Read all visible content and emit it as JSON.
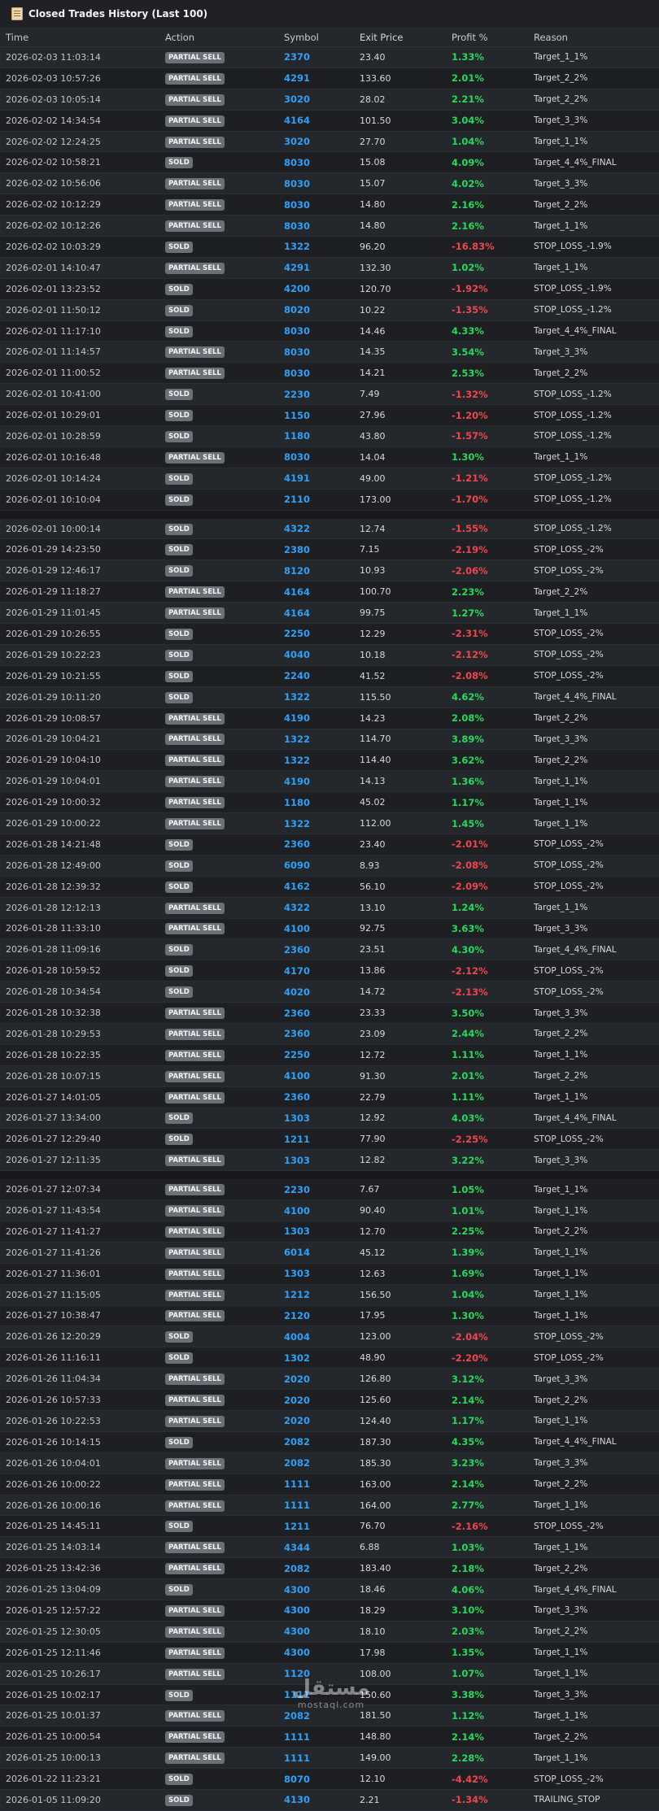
{
  "header": {
    "title": "Closed Trades History (Last 100)",
    "icon": "scroll-icon"
  },
  "columns": {
    "time": "Time",
    "action": "Action",
    "symbol": "Symbol",
    "exit_price": "Exit Price",
    "profit": "Profit %",
    "reason": "Reason"
  },
  "colors": {
    "positive": "#28d85c",
    "negative": "#f0454c",
    "symbol": "#2fa0f5",
    "badge": "#6b6f76"
  },
  "watermark": {
    "main": "مستقل",
    "sub": "mostaql.com"
  },
  "trades": [
    {
      "time": "2026-02-03 11:03:14",
      "action": "PARTIAL SELL",
      "symbol": "2370",
      "exit_price": "23.40",
      "profit": "1.33%",
      "reason": "Target_1_1%"
    },
    {
      "time": "2026-02-03 10:57:26",
      "action": "PARTIAL SELL",
      "symbol": "4291",
      "exit_price": "133.60",
      "profit": "2.01%",
      "reason": "Target_2_2%"
    },
    {
      "time": "2026-02-03 10:05:14",
      "action": "PARTIAL SELL",
      "symbol": "3020",
      "exit_price": "28.02",
      "profit": "2.21%",
      "reason": "Target_2_2%"
    },
    {
      "time": "2026-02-02 14:34:54",
      "action": "PARTIAL SELL",
      "symbol": "4164",
      "exit_price": "101.50",
      "profit": "3.04%",
      "reason": "Target_3_3%"
    },
    {
      "time": "2026-02-02 12:24:25",
      "action": "PARTIAL SELL",
      "symbol": "3020",
      "exit_price": "27.70",
      "profit": "1.04%",
      "reason": "Target_1_1%"
    },
    {
      "time": "2026-02-02 10:58:21",
      "action": "SOLD",
      "symbol": "8030",
      "exit_price": "15.08",
      "profit": "4.09%",
      "reason": "Target_4_4%_FINAL"
    },
    {
      "time": "2026-02-02 10:56:06",
      "action": "PARTIAL SELL",
      "symbol": "8030",
      "exit_price": "15.07",
      "profit": "4.02%",
      "reason": "Target_3_3%"
    },
    {
      "time": "2026-02-02 10:12:29",
      "action": "PARTIAL SELL",
      "symbol": "8030",
      "exit_price": "14.80",
      "profit": "2.16%",
      "reason": "Target_2_2%"
    },
    {
      "time": "2026-02-02 10:12:26",
      "action": "PARTIAL SELL",
      "symbol": "8030",
      "exit_price": "14.80",
      "profit": "2.16%",
      "reason": "Target_1_1%"
    },
    {
      "time": "2026-02-02 10:03:29",
      "action": "SOLD",
      "symbol": "1322",
      "exit_price": "96.20",
      "profit": "-16.83%",
      "reason": "STOP_LOSS_-1.9%"
    },
    {
      "time": "2026-02-01 14:10:47",
      "action": "PARTIAL SELL",
      "symbol": "4291",
      "exit_price": "132.30",
      "profit": "1.02%",
      "reason": "Target_1_1%"
    },
    {
      "time": "2026-02-01 13:23:52",
      "action": "SOLD",
      "symbol": "4200",
      "exit_price": "120.70",
      "profit": "-1.92%",
      "reason": "STOP_LOSS_-1.9%"
    },
    {
      "time": "2026-02-01 11:50:12",
      "action": "SOLD",
      "symbol": "8020",
      "exit_price": "10.22",
      "profit": "-1.35%",
      "reason": "STOP_LOSS_-1.2%"
    },
    {
      "time": "2026-02-01 11:17:10",
      "action": "SOLD",
      "symbol": "8030",
      "exit_price": "14.46",
      "profit": "4.33%",
      "reason": "Target_4_4%_FINAL"
    },
    {
      "time": "2026-02-01 11:14:57",
      "action": "PARTIAL SELL",
      "symbol": "8030",
      "exit_price": "14.35",
      "profit": "3.54%",
      "reason": "Target_3_3%"
    },
    {
      "time": "2026-02-01 11:00:52",
      "action": "PARTIAL SELL",
      "symbol": "8030",
      "exit_price": "14.21",
      "profit": "2.53%",
      "reason": "Target_2_2%"
    },
    {
      "time": "2026-02-01 10:41:00",
      "action": "SOLD",
      "symbol": "2230",
      "exit_price": "7.49",
      "profit": "-1.32%",
      "reason": "STOP_LOSS_-1.2%"
    },
    {
      "time": "2026-02-01 10:29:01",
      "action": "SOLD",
      "symbol": "1150",
      "exit_price": "27.96",
      "profit": "-1.20%",
      "reason": "STOP_LOSS_-1.2%"
    },
    {
      "time": "2026-02-01 10:28:59",
      "action": "SOLD",
      "symbol": "1180",
      "exit_price": "43.80",
      "profit": "-1.57%",
      "reason": "STOP_LOSS_-1.2%"
    },
    {
      "time": "2026-02-01 10:16:48",
      "action": "PARTIAL SELL",
      "symbol": "8030",
      "exit_price": "14.04",
      "profit": "1.30%",
      "reason": "Target_1_1%"
    },
    {
      "time": "2026-02-01 10:14:24",
      "action": "SOLD",
      "symbol": "4191",
      "exit_price": "49.00",
      "profit": "-1.21%",
      "reason": "STOP_LOSS_-1.2%"
    },
    {
      "time": "2026-02-01 10:10:04",
      "action": "SOLD",
      "symbol": "2110",
      "exit_price": "173.00",
      "profit": "-1.70%",
      "reason": "STOP_LOSS_-1.2%"
    },
    {
      "time": "2026-02-01 10:00:14",
      "action": "SOLD",
      "symbol": "4322",
      "exit_price": "12.74",
      "profit": "-1.55%",
      "reason": "STOP_LOSS_-1.2%"
    },
    {
      "time": "2026-01-29 14:23:50",
      "action": "SOLD",
      "symbol": "2380",
      "exit_price": "7.15",
      "profit": "-2.19%",
      "reason": "STOP_LOSS_-2%"
    },
    {
      "time": "2026-01-29 12:46:17",
      "action": "SOLD",
      "symbol": "8120",
      "exit_price": "10.93",
      "profit": "-2.06%",
      "reason": "STOP_LOSS_-2%"
    },
    {
      "time": "2026-01-29 11:18:27",
      "action": "PARTIAL SELL",
      "symbol": "4164",
      "exit_price": "100.70",
      "profit": "2.23%",
      "reason": "Target_2_2%"
    },
    {
      "time": "2026-01-29 11:01:45",
      "action": "PARTIAL SELL",
      "symbol": "4164",
      "exit_price": "99.75",
      "profit": "1.27%",
      "reason": "Target_1_1%"
    },
    {
      "time": "2026-01-29 10:26:55",
      "action": "SOLD",
      "symbol": "2250",
      "exit_price": "12.29",
      "profit": "-2.31%",
      "reason": "STOP_LOSS_-2%"
    },
    {
      "time": "2026-01-29 10:22:23",
      "action": "SOLD",
      "symbol": "4040",
      "exit_price": "10.18",
      "profit": "-2.12%",
      "reason": "STOP_LOSS_-2%"
    },
    {
      "time": "2026-01-29 10:21:55",
      "action": "SOLD",
      "symbol": "2240",
      "exit_price": "41.52",
      "profit": "-2.08%",
      "reason": "STOP_LOSS_-2%"
    },
    {
      "time": "2026-01-29 10:11:20",
      "action": "SOLD",
      "symbol": "1322",
      "exit_price": "115.50",
      "profit": "4.62%",
      "reason": "Target_4_4%_FINAL"
    },
    {
      "time": "2026-01-29 10:08:57",
      "action": "PARTIAL SELL",
      "symbol": "4190",
      "exit_price": "14.23",
      "profit": "2.08%",
      "reason": "Target_2_2%"
    },
    {
      "time": "2026-01-29 10:04:21",
      "action": "PARTIAL SELL",
      "symbol": "1322",
      "exit_price": "114.70",
      "profit": "3.89%",
      "reason": "Target_3_3%"
    },
    {
      "time": "2026-01-29 10:04:10",
      "action": "PARTIAL SELL",
      "symbol": "1322",
      "exit_price": "114.40",
      "profit": "3.62%",
      "reason": "Target_2_2%"
    },
    {
      "time": "2026-01-29 10:04:01",
      "action": "PARTIAL SELL",
      "symbol": "4190",
      "exit_price": "14.13",
      "profit": "1.36%",
      "reason": "Target_1_1%"
    },
    {
      "time": "2026-01-29 10:00:32",
      "action": "PARTIAL SELL",
      "symbol": "1180",
      "exit_price": "45.02",
      "profit": "1.17%",
      "reason": "Target_1_1%"
    },
    {
      "time": "2026-01-29 10:00:22",
      "action": "PARTIAL SELL",
      "symbol": "1322",
      "exit_price": "112.00",
      "profit": "1.45%",
      "reason": "Target_1_1%"
    },
    {
      "time": "2026-01-28 14:21:48",
      "action": "SOLD",
      "symbol": "2360",
      "exit_price": "23.40",
      "profit": "-2.01%",
      "reason": "STOP_LOSS_-2%"
    },
    {
      "time": "2026-01-28 12:49:00",
      "action": "SOLD",
      "symbol": "6090",
      "exit_price": "8.93",
      "profit": "-2.08%",
      "reason": "STOP_LOSS_-2%"
    },
    {
      "time": "2026-01-28 12:39:32",
      "action": "SOLD",
      "symbol": "4162",
      "exit_price": "56.10",
      "profit": "-2.09%",
      "reason": "STOP_LOSS_-2%"
    },
    {
      "time": "2026-01-28 12:12:13",
      "action": "PARTIAL SELL",
      "symbol": "4322",
      "exit_price": "13.10",
      "profit": "1.24%",
      "reason": "Target_1_1%"
    },
    {
      "time": "2026-01-28 11:33:10",
      "action": "PARTIAL SELL",
      "symbol": "4100",
      "exit_price": "92.75",
      "profit": "3.63%",
      "reason": "Target_3_3%"
    },
    {
      "time": "2026-01-28 11:09:16",
      "action": "SOLD",
      "symbol": "2360",
      "exit_price": "23.51",
      "profit": "4.30%",
      "reason": "Target_4_4%_FINAL"
    },
    {
      "time": "2026-01-28 10:59:52",
      "action": "SOLD",
      "symbol": "4170",
      "exit_price": "13.86",
      "profit": "-2.12%",
      "reason": "STOP_LOSS_-2%"
    },
    {
      "time": "2026-01-28 10:34:54",
      "action": "SOLD",
      "symbol": "4020",
      "exit_price": "14.72",
      "profit": "-2.13%",
      "reason": "STOP_LOSS_-2%"
    },
    {
      "time": "2026-01-28 10:32:38",
      "action": "PARTIAL SELL",
      "symbol": "2360",
      "exit_price": "23.33",
      "profit": "3.50%",
      "reason": "Target_3_3%"
    },
    {
      "time": "2026-01-28 10:29:53",
      "action": "PARTIAL SELL",
      "symbol": "2360",
      "exit_price": "23.09",
      "profit": "2.44%",
      "reason": "Target_2_2%"
    },
    {
      "time": "2026-01-28 10:22:35",
      "action": "PARTIAL SELL",
      "symbol": "2250",
      "exit_price": "12.72",
      "profit": "1.11%",
      "reason": "Target_1_1%"
    },
    {
      "time": "2026-01-28 10:07:15",
      "action": "PARTIAL SELL",
      "symbol": "4100",
      "exit_price": "91.30",
      "profit": "2.01%",
      "reason": "Target_2_2%"
    },
    {
      "time": "2026-01-27 14:01:05",
      "action": "PARTIAL SELL",
      "symbol": "2360",
      "exit_price": "22.79",
      "profit": "1.11%",
      "reason": "Target_1_1%"
    },
    {
      "time": "2026-01-27 13:34:00",
      "action": "SOLD",
      "symbol": "1303",
      "exit_price": "12.92",
      "profit": "4.03%",
      "reason": "Target_4_4%_FINAL"
    },
    {
      "time": "2026-01-27 12:29:40",
      "action": "SOLD",
      "symbol": "1211",
      "exit_price": "77.90",
      "profit": "-2.25%",
      "reason": "STOP_LOSS_-2%"
    },
    {
      "time": "2026-01-27 12:11:35",
      "action": "PARTIAL SELL",
      "symbol": "1303",
      "exit_price": "12.82",
      "profit": "3.22%",
      "reason": "Target_3_3%"
    },
    {
      "time": "2026-01-27 12:07:34",
      "action": "PARTIAL SELL",
      "symbol": "2230",
      "exit_price": "7.67",
      "profit": "1.05%",
      "reason": "Target_1_1%"
    },
    {
      "time": "2026-01-27 11:43:54",
      "action": "PARTIAL SELL",
      "symbol": "4100",
      "exit_price": "90.40",
      "profit": "1.01%",
      "reason": "Target_1_1%"
    },
    {
      "time": "2026-01-27 11:41:27",
      "action": "PARTIAL SELL",
      "symbol": "1303",
      "exit_price": "12.70",
      "profit": "2.25%",
      "reason": "Target_2_2%"
    },
    {
      "time": "2026-01-27 11:41:26",
      "action": "PARTIAL SELL",
      "symbol": "6014",
      "exit_price": "45.12",
      "profit": "1.39%",
      "reason": "Target_1_1%"
    },
    {
      "time": "2026-01-27 11:36:01",
      "action": "PARTIAL SELL",
      "symbol": "1303",
      "exit_price": "12.63",
      "profit": "1.69%",
      "reason": "Target_1_1%"
    },
    {
      "time": "2026-01-27 11:15:05",
      "action": "PARTIAL SELL",
      "symbol": "1212",
      "exit_price": "156.50",
      "profit": "1.04%",
      "reason": "Target_1_1%"
    },
    {
      "time": "2026-01-27 10:38:47",
      "action": "PARTIAL SELL",
      "symbol": "2120",
      "exit_price": "17.95",
      "profit": "1.30%",
      "reason": "Target_1_1%"
    },
    {
      "time": "2026-01-26 12:20:29",
      "action": "SOLD",
      "symbol": "4004",
      "exit_price": "123.00",
      "profit": "-2.04%",
      "reason": "STOP_LOSS_-2%"
    },
    {
      "time": "2026-01-26 11:16:11",
      "action": "SOLD",
      "symbol": "1302",
      "exit_price": "48.90",
      "profit": "-2.20%",
      "reason": "STOP_LOSS_-2%"
    },
    {
      "time": "2026-01-26 11:04:34",
      "action": "PARTIAL SELL",
      "symbol": "2020",
      "exit_price": "126.80",
      "profit": "3.12%",
      "reason": "Target_3_3%"
    },
    {
      "time": "2026-01-26 10:57:33",
      "action": "PARTIAL SELL",
      "symbol": "2020",
      "exit_price": "125.60",
      "profit": "2.14%",
      "reason": "Target_2_2%"
    },
    {
      "time": "2026-01-26 10:22:53",
      "action": "PARTIAL SELL",
      "symbol": "2020",
      "exit_price": "124.40",
      "profit": "1.17%",
      "reason": "Target_1_1%"
    },
    {
      "time": "2026-01-26 10:14:15",
      "action": "SOLD",
      "symbol": "2082",
      "exit_price": "187.30",
      "profit": "4.35%",
      "reason": "Target_4_4%_FINAL"
    },
    {
      "time": "2026-01-26 10:04:01",
      "action": "PARTIAL SELL",
      "symbol": "2082",
      "exit_price": "185.30",
      "profit": "3.23%",
      "reason": "Target_3_3%"
    },
    {
      "time": "2026-01-26 10:00:22",
      "action": "PARTIAL SELL",
      "symbol": "1111",
      "exit_price": "163.00",
      "profit": "2.14%",
      "reason": "Target_2_2%"
    },
    {
      "time": "2026-01-26 10:00:16",
      "action": "PARTIAL SELL",
      "symbol": "1111",
      "exit_price": "164.00",
      "profit": "2.77%",
      "reason": "Target_1_1%"
    },
    {
      "time": "2026-01-25 14:45:11",
      "action": "SOLD",
      "symbol": "1211",
      "exit_price": "76.70",
      "profit": "-2.16%",
      "reason": "STOP_LOSS_-2%"
    },
    {
      "time": "2026-01-25 14:03:14",
      "action": "PARTIAL SELL",
      "symbol": "4344",
      "exit_price": "6.88",
      "profit": "1.03%",
      "reason": "Target_1_1%"
    },
    {
      "time": "2026-01-25 13:42:36",
      "action": "PARTIAL SELL",
      "symbol": "2082",
      "exit_price": "183.40",
      "profit": "2.18%",
      "reason": "Target_2_2%"
    },
    {
      "time": "2026-01-25 13:04:09",
      "action": "SOLD",
      "symbol": "4300",
      "exit_price": "18.46",
      "profit": "4.06%",
      "reason": "Target_4_4%_FINAL"
    },
    {
      "time": "2026-01-25 12:57:22",
      "action": "PARTIAL SELL",
      "symbol": "4300",
      "exit_price": "18.29",
      "profit": "3.10%",
      "reason": "Target_3_3%"
    },
    {
      "time": "2026-01-25 12:30:05",
      "action": "PARTIAL SELL",
      "symbol": "4300",
      "exit_price": "18.10",
      "profit": "2.03%",
      "reason": "Target_2_2%"
    },
    {
      "time": "2026-01-25 12:11:46",
      "action": "PARTIAL SELL",
      "symbol": "4300",
      "exit_price": "17.98",
      "profit": "1.35%",
      "reason": "Target_1_1%"
    },
    {
      "time": "2026-01-25 10:26:17",
      "action": "PARTIAL SELL",
      "symbol": "1120",
      "exit_price": "108.00",
      "profit": "1.07%",
      "reason": "Target_1_1%"
    },
    {
      "time": "2026-01-25 10:02:17",
      "action": "SOLD",
      "symbol": "1111",
      "exit_price": "150.60",
      "profit": "3.38%",
      "reason": "Target_3_3%"
    },
    {
      "time": "2026-01-25 10:01:37",
      "action": "PARTIAL SELL",
      "symbol": "2082",
      "exit_price": "181.50",
      "profit": "1.12%",
      "reason": "Target_1_1%"
    },
    {
      "time": "2026-01-25 10:00:54",
      "action": "PARTIAL SELL",
      "symbol": "1111",
      "exit_price": "148.80",
      "profit": "2.14%",
      "reason": "Target_2_2%"
    },
    {
      "time": "2026-01-25 10:00:13",
      "action": "PARTIAL SELL",
      "symbol": "1111",
      "exit_price": "149.00",
      "profit": "2.28%",
      "reason": "Target_1_1%"
    },
    {
      "time": "2026-01-22 11:23:21",
      "action": "SOLD",
      "symbol": "8070",
      "exit_price": "12.10",
      "profit": "-4.42%",
      "reason": "STOP_LOSS_-2%"
    },
    {
      "time": "2026-01-05 11:09:20",
      "action": "SOLD",
      "symbol": "4130",
      "exit_price": "2.21",
      "profit": "-1.34%",
      "reason": "TRAILING_STOP"
    }
  ]
}
